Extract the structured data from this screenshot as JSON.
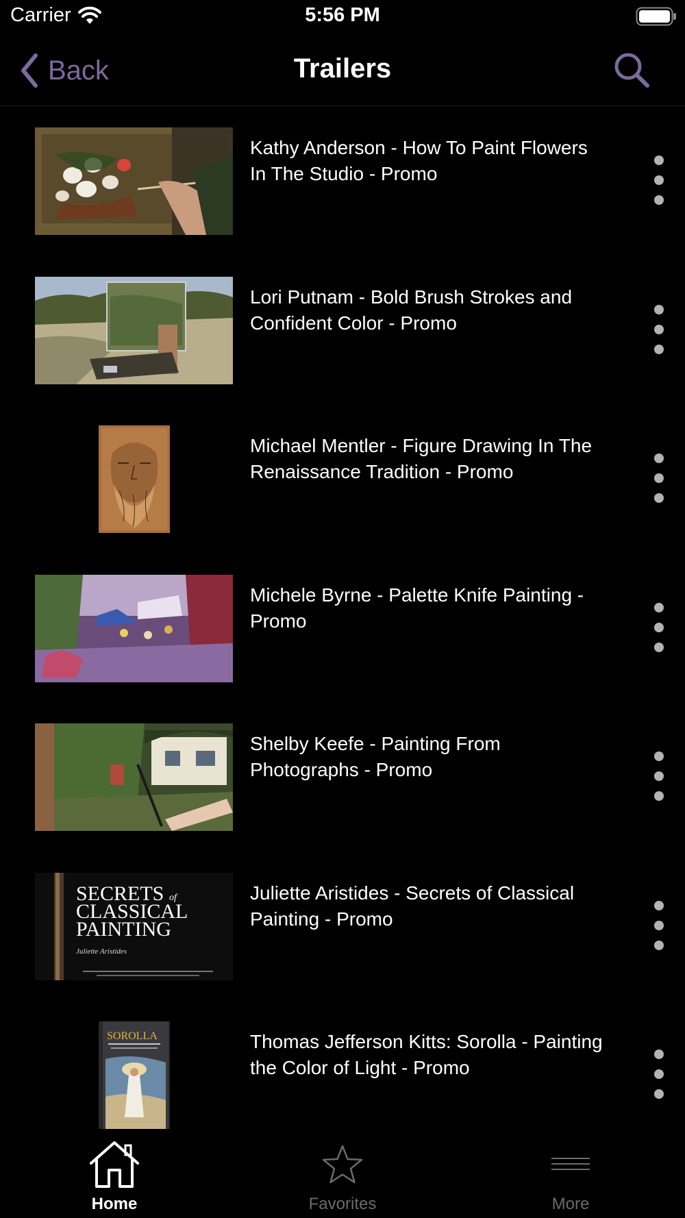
{
  "status_bar": {
    "carrier": "Carrier",
    "time": "5:56 PM"
  },
  "nav": {
    "back_label": "Back",
    "title": "Trailers"
  },
  "trailers": [
    {
      "title": "Kathy Anderson - How To Paint Flowers In The Studio - Promo"
    },
    {
      "title": "Lori Putnam - Bold Brush Strokes and Confident Color - Promo"
    },
    {
      "title": "Michael Mentler - Figure Drawing In The Renaissance Tradition - Promo"
    },
    {
      "title": "Michele Byrne - Palette Knife Painting - Promo"
    },
    {
      "title": "Shelby Keefe - Painting From Photographs - Promo"
    },
    {
      "title": "Juliette Aristides - Secrets of Classical Painting - Promo",
      "thumb_text": {
        "line1": "SECRETS",
        "of": "of",
        "line2": "CLASSICAL",
        "line3": "PAINTING",
        "author": "Juliette Aristides"
      }
    },
    {
      "title": "Thomas Jefferson Kitts: Sorolla - Painting the Color of Light - Promo",
      "thumb_text": {
        "cover": "SOROLLA"
      }
    }
  ],
  "tabs": [
    {
      "label": "Home",
      "icon": "home-icon",
      "active": true
    },
    {
      "label": "Favorites",
      "icon": "star-icon",
      "active": false
    },
    {
      "label": "More",
      "icon": "menu-lines-icon",
      "active": false
    }
  ],
  "colors": {
    "accent": "#7b6a9c",
    "background": "#000000",
    "tab_inactive": "#6b6b6b"
  }
}
